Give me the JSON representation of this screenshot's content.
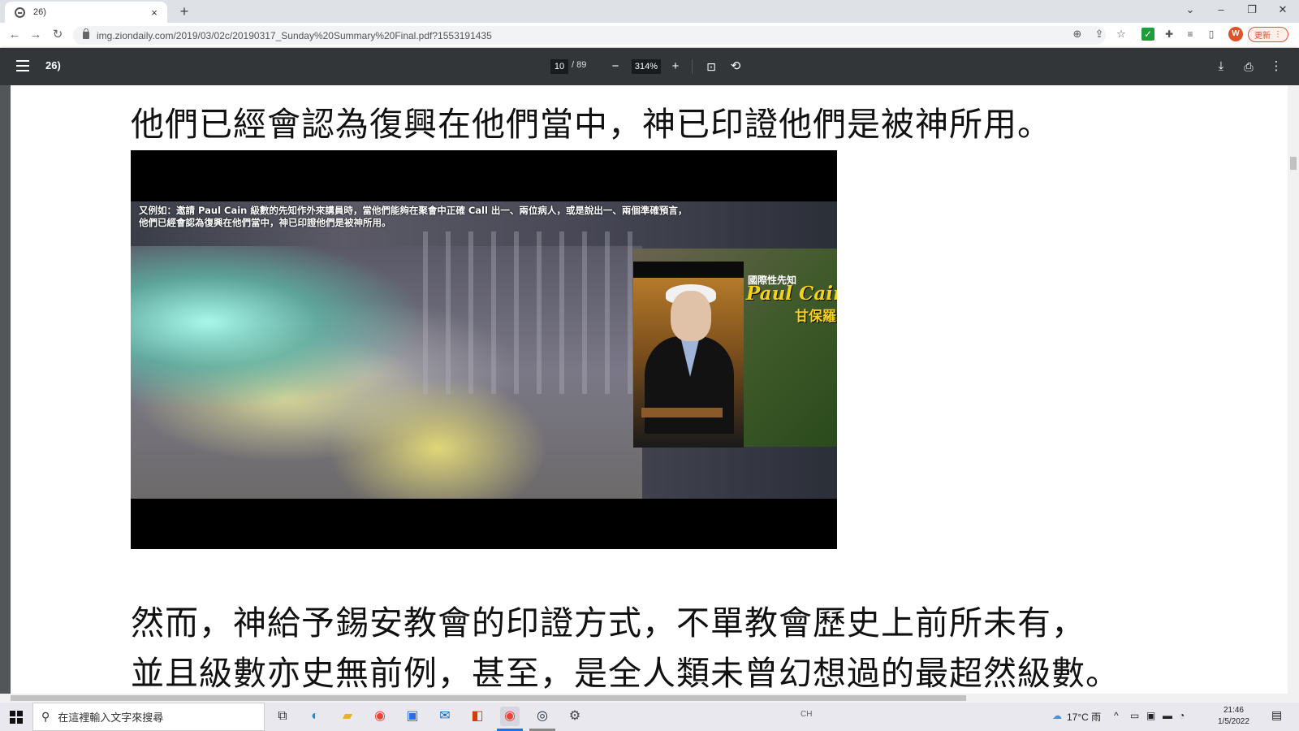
{
  "browser": {
    "tab": {
      "title": "26)",
      "close": "×"
    },
    "new_tab": "+",
    "window_controls": {
      "tab_search": "⌄",
      "minimize": "–",
      "restore": "❐",
      "close": "✕"
    },
    "url": "img.ziondaily.com/2019/03/02c/20190317_Sunday%20Summary%20Final.pdf?1553191435",
    "avatar_letter": "W",
    "update_label": "更新"
  },
  "pdf_viewer": {
    "title": "26)",
    "current_page": "10",
    "page_separator": "/",
    "total_pages": "89",
    "zoom": "314%"
  },
  "document": {
    "heading_line": "他們已經會認為復興在他們當中，神已印證他們是被神所用。",
    "slide": {
      "caption_line1": "又例如：邀請 Paul Cain 級數的先知作外來講員時，當他們能夠在聚會中正確 Call 出一、兩位病人，或是說出一、兩個準確預言，",
      "caption_line2": "他們已經會認為復興在他們當中，神已印證他們是被神所用。",
      "label_cn": "國際性先知",
      "label_en": "Paul Cain",
      "label_zh": "甘保羅"
    },
    "paragraph_line1": "然而，神給予錫安教會的印證方式，不單教會歷史上前所未有，",
    "paragraph_line2": "並且級數亦史無前例，甚至，是全人類未曾幻想過的最超然級數。"
  },
  "taskbar": {
    "search_placeholder": "在這裡輸入文字來搜尋",
    "ime": "CH",
    "weather": "17°C 雨",
    "time": "21:46",
    "date": "1/5/2022"
  }
}
